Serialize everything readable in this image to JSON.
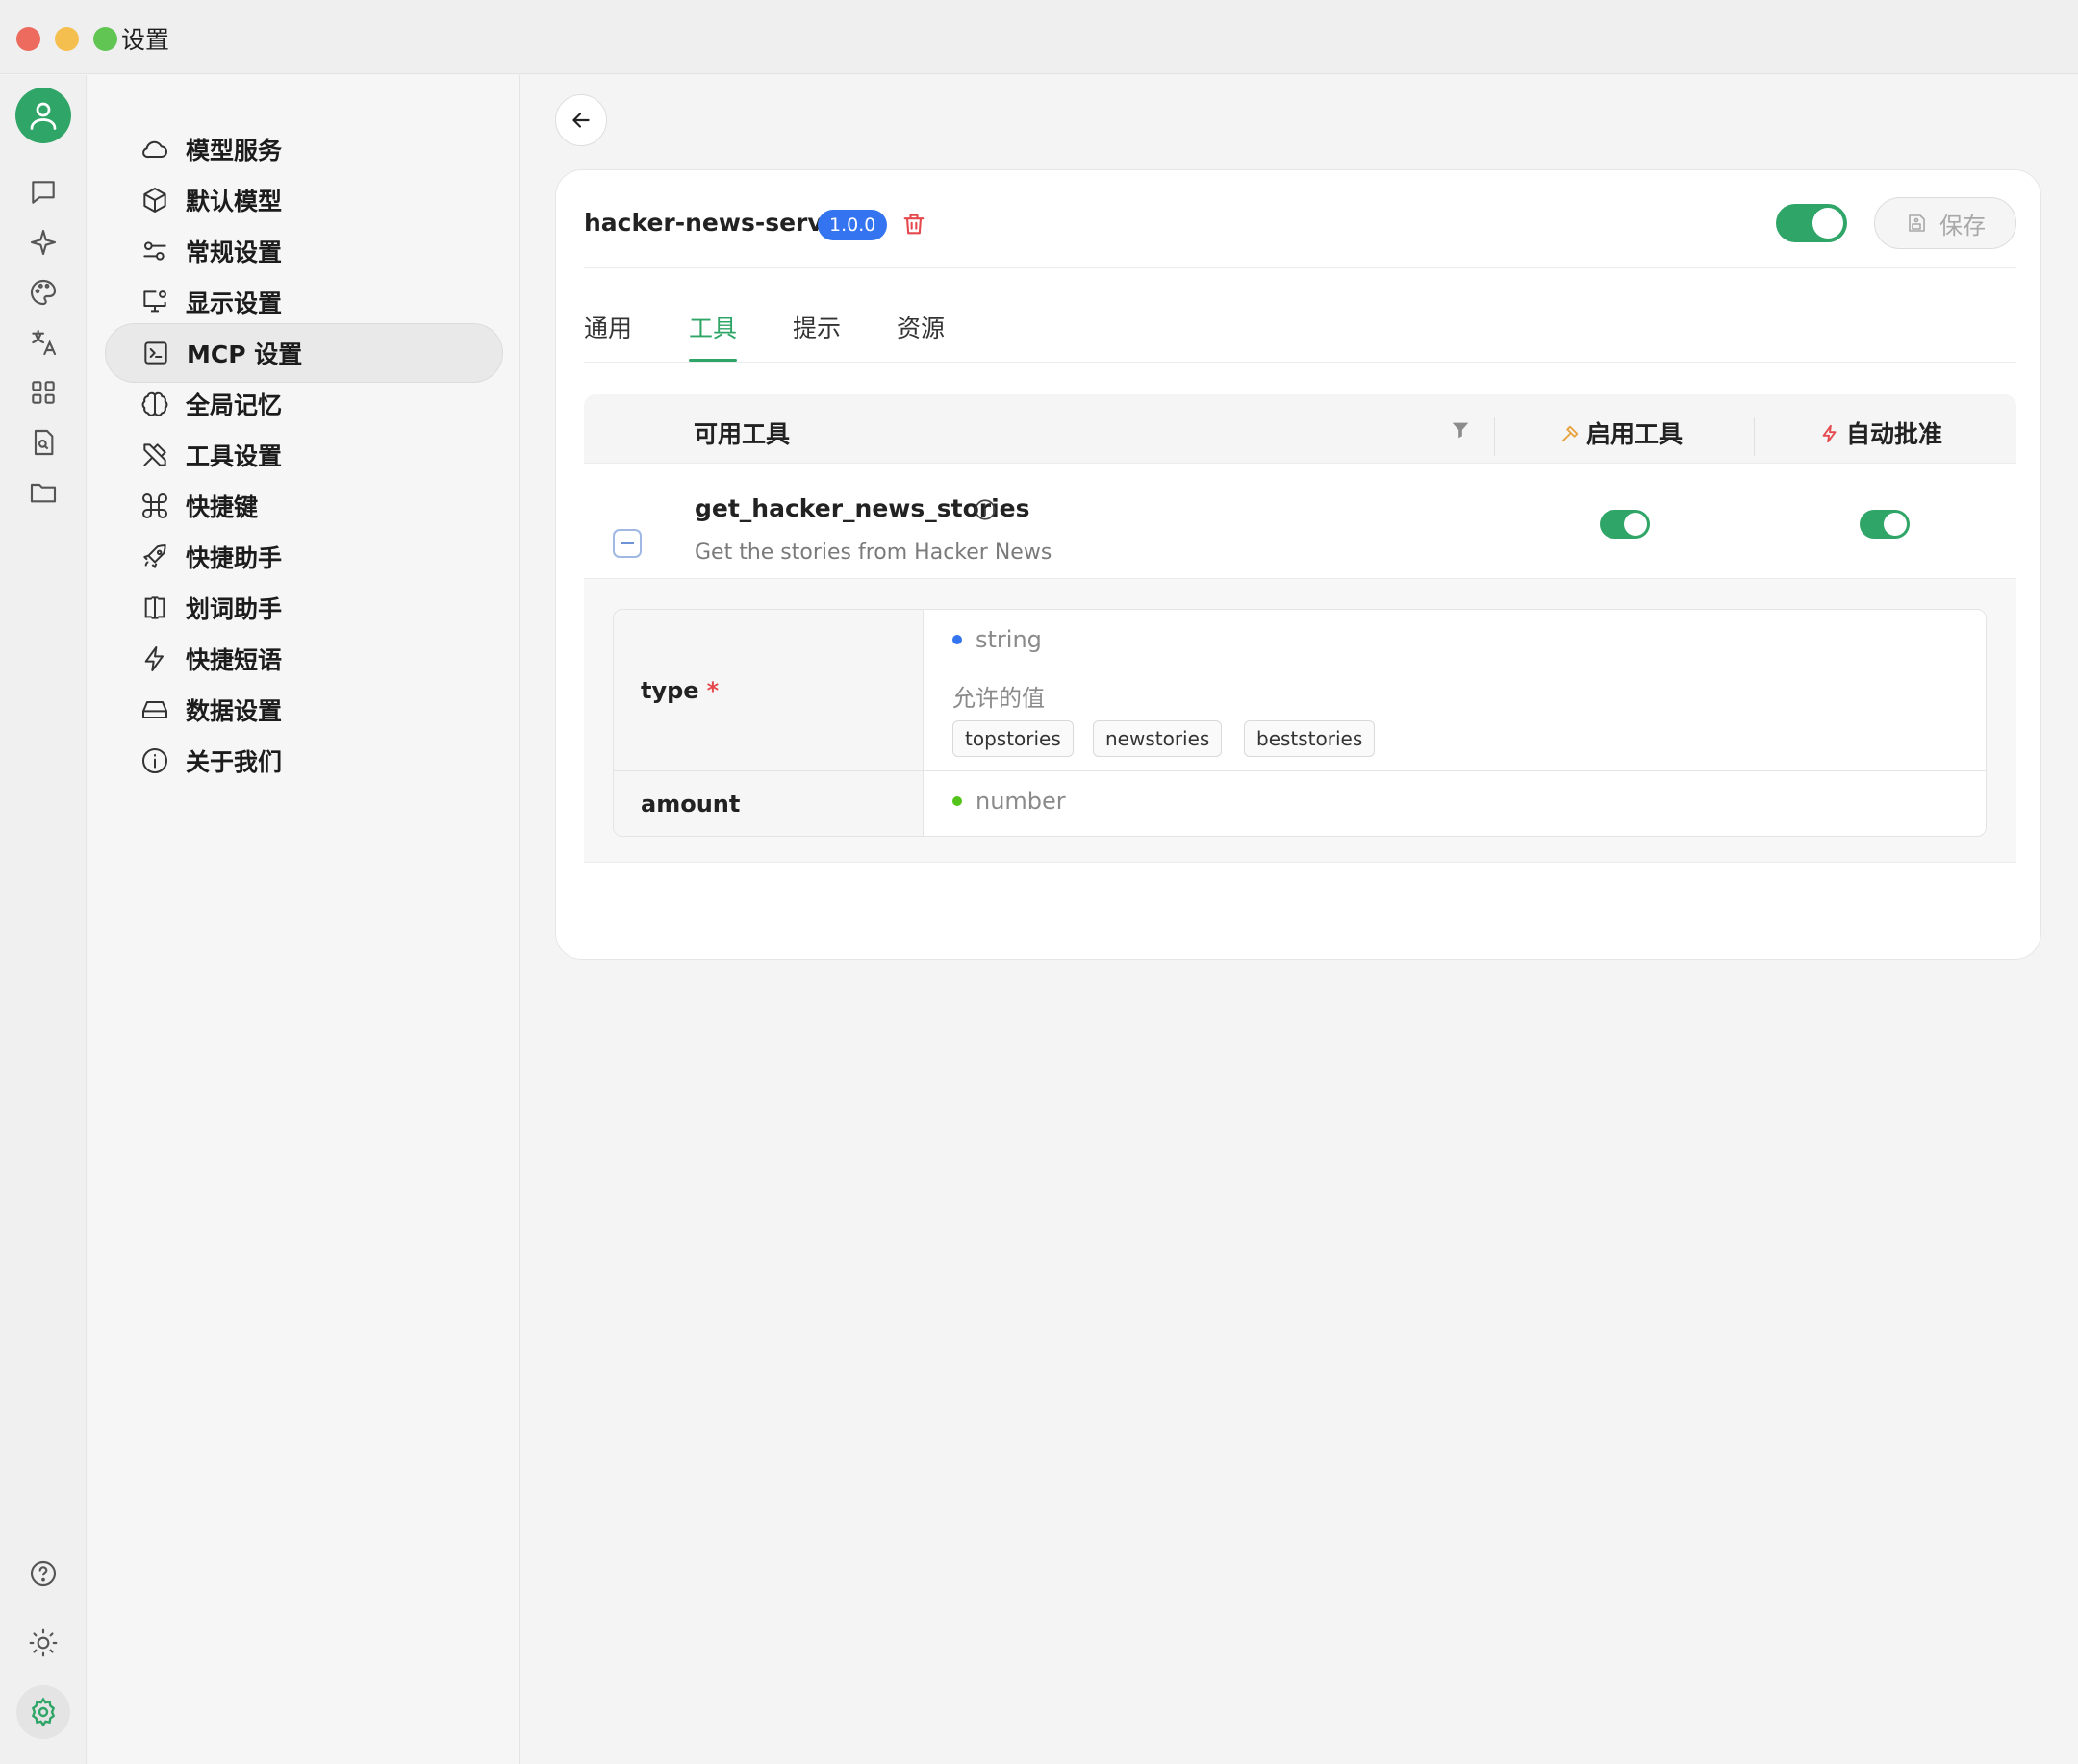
{
  "window": {
    "title": "设置"
  },
  "menu": {
    "items": [
      {
        "label": "模型服务",
        "icon": "cloud-icon"
      },
      {
        "label": "默认模型",
        "icon": "cube-icon"
      },
      {
        "label": "常规设置",
        "icon": "sliders-icon"
      },
      {
        "label": "显示设置",
        "icon": "monitor-gear-icon"
      },
      {
        "label": "MCP 设置",
        "icon": "terminal-icon",
        "active": true
      },
      {
        "label": "全局记忆",
        "icon": "brain-icon"
      },
      {
        "label": "工具设置",
        "icon": "tools-icon"
      },
      {
        "label": "快捷键",
        "icon": "command-icon"
      },
      {
        "label": "快捷助手",
        "icon": "rocket-icon"
      },
      {
        "label": "划词助手",
        "icon": "text-cursor-icon"
      },
      {
        "label": "快捷短语",
        "icon": "zap-icon"
      },
      {
        "label": "数据设置",
        "icon": "hard-drive-icon"
      },
      {
        "label": "关于我们",
        "icon": "info-icon"
      }
    ]
  },
  "server": {
    "name": "hacker-news-server",
    "version": "1.0.0",
    "enabled": true,
    "save_label": "保存"
  },
  "tabs": [
    {
      "label": "通用"
    },
    {
      "label": "工具",
      "active": true
    },
    {
      "label": "提示"
    },
    {
      "label": "资源"
    }
  ],
  "tools_table": {
    "col_available": "可用工具",
    "col_enable": "启用工具",
    "col_auto_approve": "自动批准",
    "rows": [
      {
        "name": "get_hacker_news_stories",
        "description": "Get the stories from Hacker News",
        "enabled": true,
        "auto_approve": true,
        "params": [
          {
            "key": "type",
            "required": true,
            "type": "string",
            "allowed_label": "允许的值",
            "allowed_values": [
              "topstories",
              "newstories",
              "beststories"
            ]
          },
          {
            "key": "amount",
            "required": false,
            "type": "number"
          }
        ]
      }
    ]
  },
  "colors": {
    "accent": "#2fa567",
    "badge": "#3574f0",
    "danger": "#e5484d",
    "string_dot": "#3574f0",
    "number_dot": "#52c41a"
  }
}
